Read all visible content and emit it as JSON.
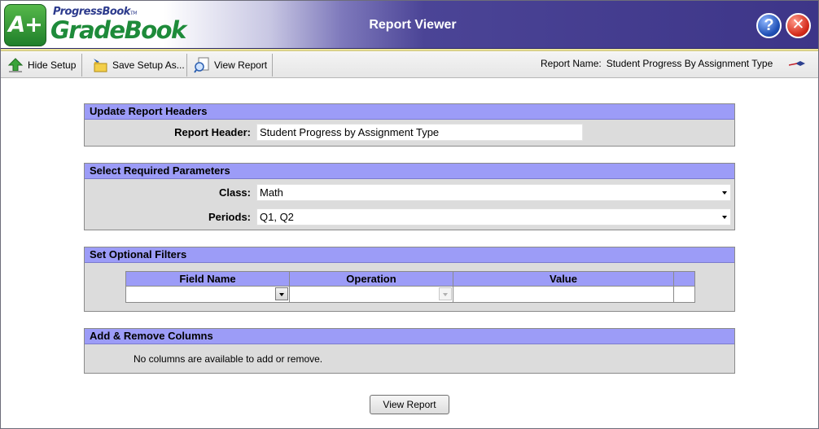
{
  "app": {
    "logo_mark": "A+",
    "logo_brand": "ProgressBook",
    "logo_tm": "TM",
    "logo_product": "GradeBook",
    "title": "Report Viewer",
    "help_glyph": "?",
    "close_glyph": "✕"
  },
  "toolbar": {
    "hide_setup": "Hide Setup",
    "save_setup_as": "Save Setup As...",
    "view_report": "View Report",
    "report_name_label": "Report Name:",
    "report_name_value": "Student Progress By Assignment Type"
  },
  "sections": {
    "headers": {
      "title": "Update Report Headers",
      "report_header_label": "Report Header:",
      "report_header_value": "Student Progress by Assignment Type"
    },
    "required": {
      "title": "Select Required Parameters",
      "class_label": "Class:",
      "class_value": "Math",
      "periods_label": "Periods:",
      "periods_value": "Q1, Q2"
    },
    "filters": {
      "title": "Set Optional Filters",
      "columns": [
        "Field Name",
        "Operation",
        "Value",
        ""
      ]
    },
    "columns": {
      "title": "Add & Remove Columns",
      "note": "No columns are available to add or remove."
    }
  },
  "footer": {
    "view_report_button": "View Report"
  }
}
